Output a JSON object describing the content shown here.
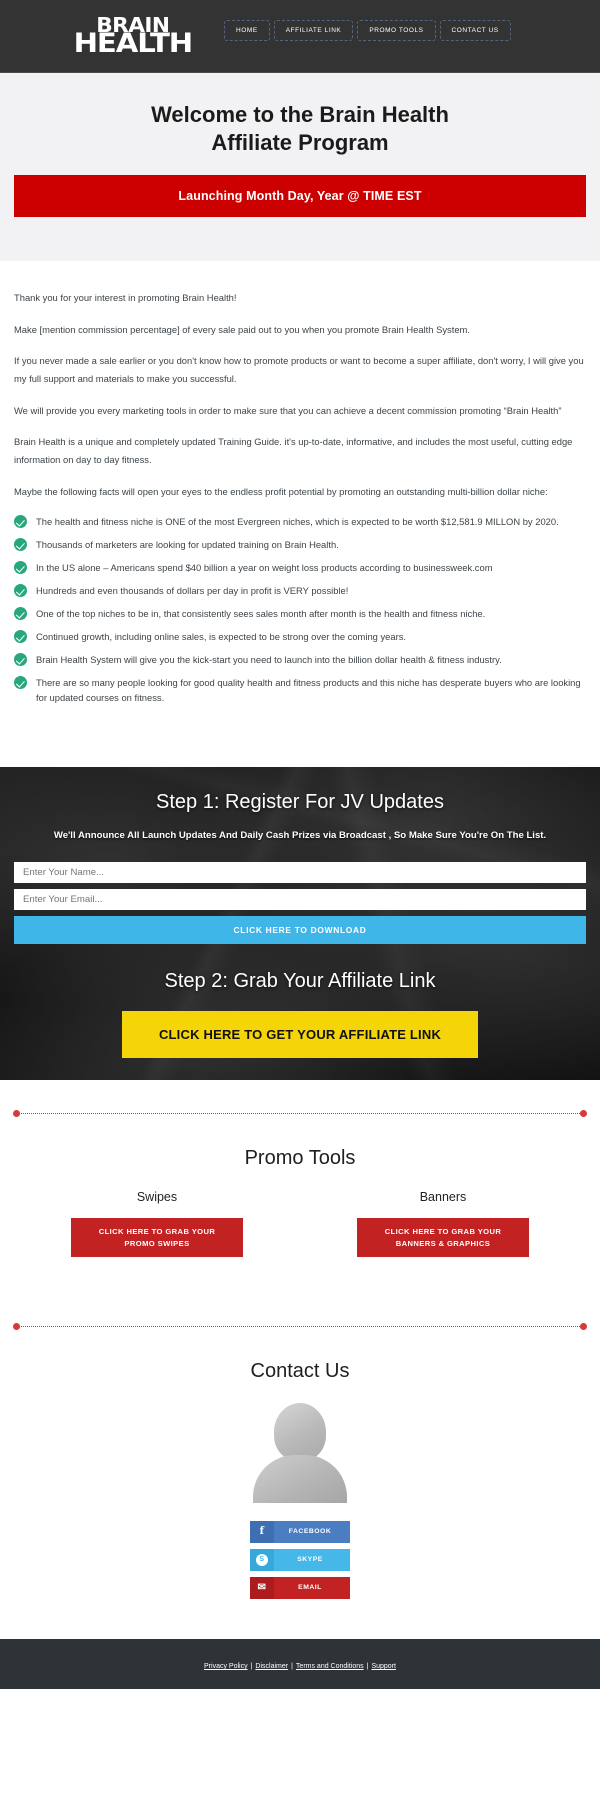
{
  "header": {
    "logo_line1": "BRAIN",
    "logo_line2": "HEALTH",
    "nav": [
      {
        "label": "HOME"
      },
      {
        "label": "AFFILIATE LINK"
      },
      {
        "label": "PROMO TOOLS"
      },
      {
        "label": "CONTACT US"
      }
    ]
  },
  "hero": {
    "title": "Welcome to the Brain Health Affiliate Program",
    "launch_banner": "Launching Month Day, Year @ TIME EST"
  },
  "content": {
    "paragraphs": [
      "Thank you for your interest in promoting Brain Health!",
      "Make [mention commission percentage] of every sale paid out to you when you promote Brain Health System.",
      "If you never made a sale earlier or you don't know how to promote products or want to become a super affiliate, don't worry, I will give you my full support and materials to make you successful.",
      "We will provide you every marketing tools in order to make sure that you can achieve a decent commission promoting “Brain Health”",
      "Brain Health is a unique and completely updated Training Guide. it's up-to-date, informative, and includes the most useful, cutting edge information on day to day fitness.",
      "Maybe the following facts will open your eyes to the endless profit potential by promoting an outstanding multi-billion dollar niche:"
    ],
    "facts": [
      "The health and fitness niche is ONE of the most Evergreen niches, which is expected to be worth $12,581.9 MILLON by 2020.",
      "Thousands of marketers are looking for updated training on Brain Health.",
      "In the US alone – Americans spend $40 billion a year on weight loss products according to businessweek.com",
      "Hundreds and even thousands of dollars per day in profit is VERY possible!",
      "One of the top niches to be in, that consistently sees sales month after month is the health and fitness niche.",
      "Continued growth, including online sales, is expected to be strong over the coming years.",
      "Brain Health System will give you the kick-start you need to launch into the billion dollar health & fitness industry.",
      "There are so many people looking for good quality health and fitness products and this niche has desperate buyers who are looking for updated courses on fitness."
    ]
  },
  "optin": {
    "step1_title": "Step 1: Register For JV Updates",
    "step1_subtitle": "We'll Announce All Launch Updates And Daily Cash Prizes via Broadcast , So Make Sure You're On The List.",
    "name_placeholder": "Enter Your Name...",
    "name_value": "",
    "email_placeholder": "Enter Your Email...",
    "email_value": "",
    "download_button": "CLICK HERE TO DOWNLOAD",
    "step2_title": "Step 2: Grab Your Affiliate Link",
    "affiliate_button": "CLICK HERE TO GET YOUR AFFILIATE LINK"
  },
  "promo": {
    "title": "Promo Tools",
    "columns": [
      {
        "heading": "Swipes",
        "button_line1": "CLICK HERE TO GRAB YOUR",
        "button_line2": "PROMO SWIPES"
      },
      {
        "heading": "Banners",
        "button_line1": "CLICK HERE TO GRAB YOUR",
        "button_line2": "BANNERS & GRAPHICS"
      }
    ]
  },
  "contact": {
    "title": "Contact Us",
    "social": [
      {
        "label": "FACEBOOK",
        "icon": "facebook-icon",
        "glyph": "f",
        "color": "#4a7dc2"
      },
      {
        "label": "SKYPE",
        "icon": "skype-icon",
        "glyph": "S",
        "color": "#45b7e8"
      },
      {
        "label": "EMAIL",
        "icon": "email-icon",
        "glyph": "✉",
        "color": "#c32222"
      }
    ]
  },
  "footer": {
    "links": [
      {
        "label": "Privacy Policy"
      },
      {
        "label": "Disclaimer"
      },
      {
        "label": "Terms and Conditions"
      },
      {
        "label": "Support"
      }
    ],
    "separator": "|"
  },
  "colors": {
    "header_bg": "#333333",
    "hero_bg": "#f2f2f4",
    "launch_red": "#cc0000",
    "check_green": "#28a77f",
    "cta_blue": "#3fb6e8",
    "cta_yellow": "#f5d507",
    "promo_red": "#c32222",
    "divider_red": "#d63a3a",
    "footer_bg": "#2e3338"
  }
}
